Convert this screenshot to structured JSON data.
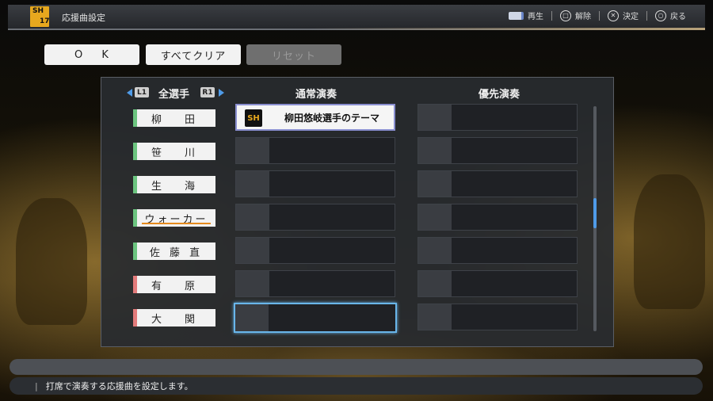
{
  "header": {
    "title": "応援曲設定",
    "logo_text": "SH",
    "logo_year": "17",
    "controls": [
      {
        "icon": "touchpad-icon",
        "label": "再生"
      },
      {
        "icon": "square-button-icon",
        "label": "解除"
      },
      {
        "icon": "cross-button-icon",
        "label": "決定"
      },
      {
        "icon": "circle-button-icon",
        "label": "戻る"
      }
    ]
  },
  "actions": {
    "ok": "O K",
    "clear_all": "すべてクリア",
    "reset": "リセット"
  },
  "table": {
    "filter_label": "全選手",
    "l1": "L1",
    "r1": "R1",
    "col_normal": "通常演奏",
    "col_priority": "優先演奏",
    "rows": [
      {
        "player": "柳　田",
        "normal": "柳田悠岐選手のテーマ",
        "priority": ""
      },
      {
        "player": "笹　川",
        "normal": "",
        "priority": ""
      },
      {
        "player": "生　海",
        "normal": "",
        "priority": ""
      },
      {
        "player": "ウォーカー",
        "normal": "",
        "priority": ""
      },
      {
        "player": "佐 藤 直",
        "normal": "",
        "priority": ""
      },
      {
        "player": "有　原",
        "normal": "",
        "priority": ""
      },
      {
        "player": "大　関",
        "normal": "",
        "priority": ""
      }
    ]
  },
  "footer": {
    "hint": "打席で演奏する応援曲を設定します。"
  }
}
